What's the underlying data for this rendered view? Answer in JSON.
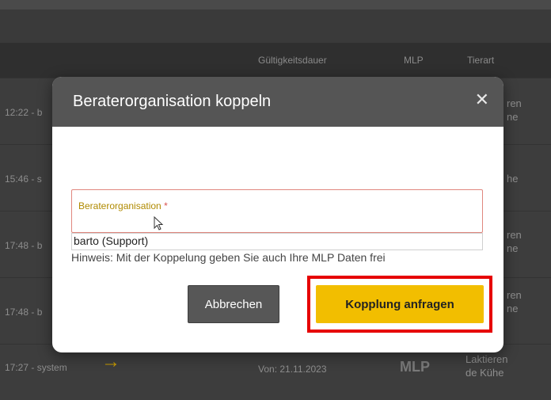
{
  "table": {
    "headers": [
      "Gültigkeitsdauer",
      "MLP",
      "Tierart"
    ],
    "rows": [
      {
        "time": "12:22 - b",
        "side": "ren\nne"
      },
      {
        "time": "15:46 - s",
        "side": "he"
      },
      {
        "time": "17:48 - b",
        "side": "ren\nne"
      },
      {
        "time": "17:48 - b",
        "side": "ren\nne"
      },
      {
        "time": "17:27 - system",
        "valid": "Von: 21.11.2023",
        "mlp": "MLP",
        "side": "Laktieren\nde Kühe"
      }
    ]
  },
  "modal": {
    "title": "Beraterorganisation koppeln",
    "close_icon": "close-icon",
    "field_label": "Beraterorganisation",
    "required_mark": "*",
    "dropdown_option": "barto (Support)",
    "hint": "Hinweis: Mit der Koppelung geben Sie auch Ihre MLP Daten frei",
    "cancel_label": "Abbrechen",
    "request_label": "Kopplung anfragen"
  },
  "colors": {
    "accent": "#f2be00",
    "highlight": "#e60000",
    "header_bg": "#555555"
  }
}
